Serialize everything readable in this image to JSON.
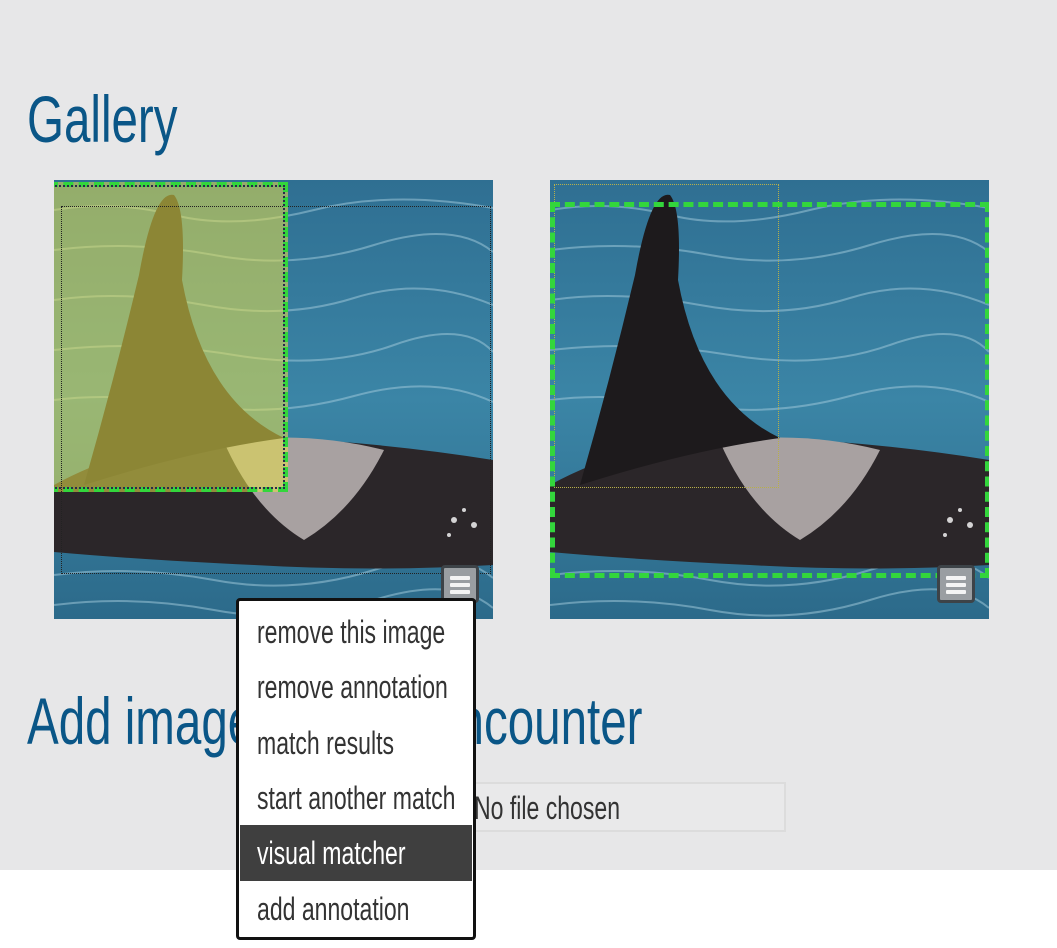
{
  "gallery": {
    "title": "Gallery",
    "images": [
      {
        "name": "orca-fin-photo-1",
        "has_menu": true
      },
      {
        "name": "orca-fin-photo-2",
        "has_menu": true
      }
    ]
  },
  "add_section": {
    "title": "Add images to this encounter",
    "file_input": {
      "status_text": "No file chosen"
    }
  },
  "context_menu": {
    "items": [
      {
        "label": "remove this image"
      },
      {
        "label": "remove annotation"
      },
      {
        "label": "match results"
      },
      {
        "label": "start another match"
      },
      {
        "label": "visual matcher",
        "highlighted": true
      },
      {
        "label": "add annotation"
      }
    ]
  },
  "colors": {
    "heading": "#0a5687",
    "panel_bg": "#e7e7e8",
    "annotation_green": "#33d63c",
    "highlight_yellow": "#e8e04a",
    "menu_highlight": "#3f3f3f"
  }
}
